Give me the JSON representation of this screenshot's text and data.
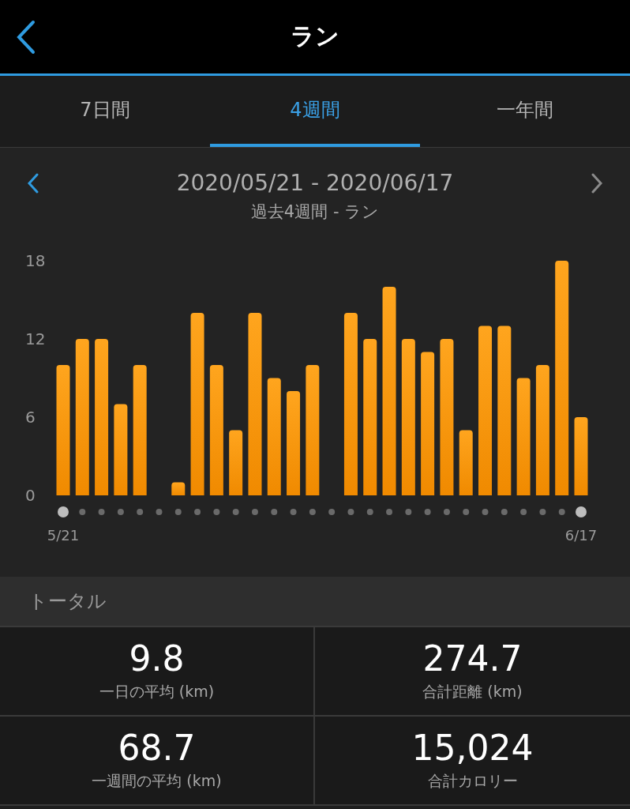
{
  "header": {
    "title": "ラン"
  },
  "tabs": [
    {
      "label": "7日間",
      "selected": false
    },
    {
      "label": "4週間",
      "selected": true
    },
    {
      "label": "一年間",
      "selected": false
    }
  ],
  "period": {
    "range": "2020/05/21 - 2020/06/17",
    "subtitle": "過去4週間 - ラン"
  },
  "chart_data": {
    "type": "bar",
    "categories": [
      "5/21",
      null,
      null,
      null,
      null,
      null,
      null,
      null,
      null,
      null,
      null,
      null,
      null,
      null,
      null,
      null,
      null,
      null,
      null,
      null,
      null,
      null,
      null,
      null,
      null,
      null,
      null,
      "6/17"
    ],
    "values": [
      10,
      12,
      12,
      7,
      10,
      0,
      1,
      14,
      10,
      5,
      14,
      9,
      8,
      10,
      0,
      14,
      12,
      16,
      12,
      11,
      12,
      5,
      13,
      13,
      9,
      10,
      18,
      6
    ],
    "ylim": [
      0,
      18
    ],
    "yticks": [
      0,
      6,
      12,
      18
    ]
  },
  "totals": {
    "heading": "トータル",
    "stats": [
      {
        "value": "9.8",
        "label": "一日の平均 (km)"
      },
      {
        "value": "274.7",
        "label": "合計距離 (km)"
      },
      {
        "value": "68.7",
        "label": "一週間の平均 (km)"
      },
      {
        "value": "15,024",
        "label": "合計カロリー"
      }
    ]
  }
}
